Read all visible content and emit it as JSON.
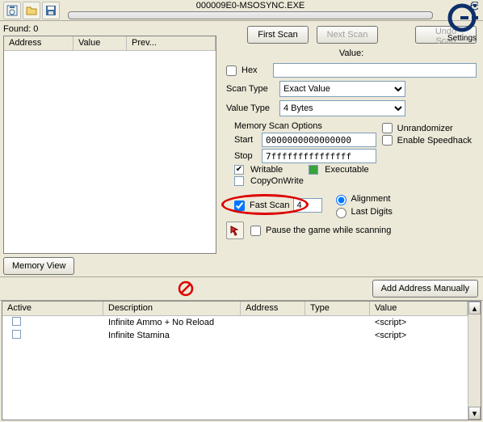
{
  "toolbar": {
    "process_title": "000009E0-MSOSYNC.EXE"
  },
  "logo_text": "Settings",
  "left": {
    "found_label": "Found: 0",
    "headers": {
      "address": "Address",
      "value": "Value",
      "prev": "Prev..."
    },
    "memory_view": "Memory View"
  },
  "scan": {
    "first_scan": "First Scan",
    "next_scan": "Next Scan",
    "undo_scan": "Undo Scan",
    "value_title": "Value:",
    "hex_label": "Hex",
    "scan_type_label": "Scan Type",
    "scan_type_value": "Exact Value",
    "value_type_label": "Value Type",
    "value_type_value": "4 Bytes",
    "memopt_title": "Memory Scan Options",
    "start_label": "Start",
    "start_value": "0000000000000000",
    "stop_label": "Stop",
    "stop_value": "7fffffffffffffff",
    "writable_label": "Writable",
    "executable_label": "Executable",
    "cow_label": "CopyOnWrite",
    "unrandomizer_label": "Unrandomizer",
    "speedhack_label": "Enable Speedhack",
    "fastscan_label": "Fast Scan",
    "fastscan_value": "4",
    "alignment_label": "Alignment",
    "lastdigits_label": "Last Digits",
    "pause_label": "Pause the game while scanning"
  },
  "midbar": {
    "add_manual": "Add Address Manually"
  },
  "table": {
    "headers": {
      "active": "Active",
      "description": "Description",
      "address": "Address",
      "type": "Type",
      "value": "Value"
    },
    "rows": [
      {
        "active": false,
        "description": "Infinite Ammo + No Reload",
        "address": "",
        "type": "",
        "value": "<script>"
      },
      {
        "active": false,
        "description": "Infinite Stamina",
        "address": "",
        "type": "",
        "value": "<script>"
      }
    ]
  }
}
